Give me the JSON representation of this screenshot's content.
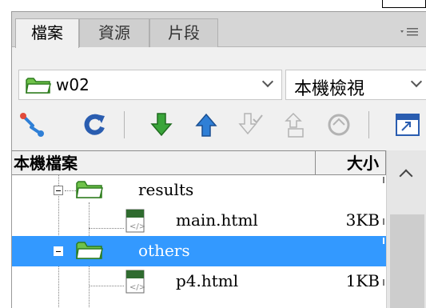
{
  "tabs": [
    {
      "label": "檔案",
      "active": true
    },
    {
      "label": "資源",
      "active": false
    },
    {
      "label": "片段",
      "active": false
    }
  ],
  "location": {
    "site_name": "w02",
    "view_label": "本機檢視"
  },
  "toolbar": {
    "buttons": [
      "connect-icon",
      "refresh-icon",
      "get-icon",
      "put-icon",
      "check-out-icon",
      "check-in-icon",
      "sync-icon",
      "expand-icon"
    ]
  },
  "file_list": {
    "header_name": "本機檔案",
    "header_size": "大小",
    "rows": [
      {
        "name": "results",
        "size": "",
        "type": "folder",
        "selected": false
      },
      {
        "name": "main.html",
        "size": "3KB",
        "type": "file",
        "selected": false
      },
      {
        "name": "others",
        "size": "",
        "type": "folder",
        "selected": true
      },
      {
        "name": "p4.html",
        "size": "1KB",
        "type": "file",
        "selected": false
      }
    ]
  },
  "colors": {
    "selection": "#3399ff",
    "folder_green": "#6fc24a",
    "arrow_green": "#3aa53a",
    "arrow_blue": "#2f7fd6",
    "refresh_blue": "#2a5db0"
  }
}
